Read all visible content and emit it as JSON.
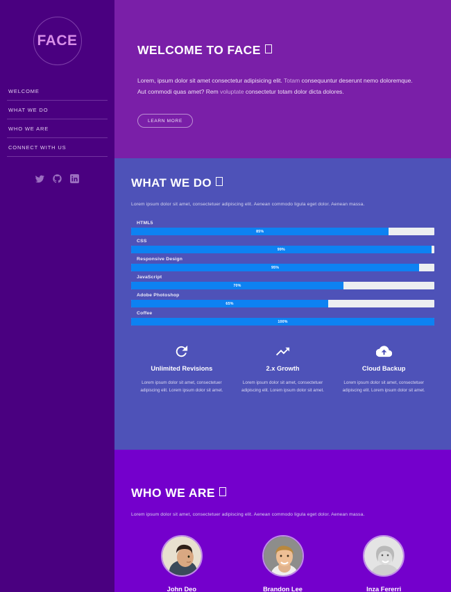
{
  "brand": {
    "logo_text": "FACE"
  },
  "sidebar": {
    "nav": [
      {
        "label": "WELCOME"
      },
      {
        "label": "WHAT WE DO"
      },
      {
        "label": "WHO WE ARE"
      },
      {
        "label": "CONNECT WITH US"
      }
    ],
    "socials": [
      {
        "name": "twitter-icon"
      },
      {
        "name": "github-icon"
      },
      {
        "name": "linkedin-icon"
      }
    ]
  },
  "welcome": {
    "title": "WELCOME TO FACE",
    "body_part1": "Lorem, ipsum dolor sit amet consectetur adipisicing elit. ",
    "body_dim1": "Totam",
    "body_part2": " consequuntur deserunt nemo doloremque. Aut commodi quas amet? Rem ",
    "body_dim2": "voluptate",
    "body_part3": " consectetur totam dolor dicta dolores.",
    "cta_label": "LEARN MORE"
  },
  "what_we_do": {
    "title": "WHAT WE DO",
    "subtitle": "Lorem ipsum dolor sit amet, consectetuer adipiscing elit. Aenean commodo ligula eget dolor. Aenean massa.",
    "features": [
      {
        "icon": "refresh-icon",
        "title": "Unlimited Revisions",
        "desc": "Lorem ipsum dolor sit amet, consectetuer adipiscing elit. Lorem ipsum dolor sit amet."
      },
      {
        "icon": "trending-up-icon",
        "title": "2.x Growth",
        "desc": "Lorem ipsum dolor sit amet, consectetuer adipiscing elit. Lorem ipsum dolor sit amet."
      },
      {
        "icon": "cloud-upload-icon",
        "title": "Cloud Backup",
        "desc": "Lorem ipsum dolor sit amet, consectetuer adipiscing elit. Lorem ipsum dolor sit amet."
      }
    ]
  },
  "who_we_are": {
    "title": "WHO WE ARE",
    "subtitle": "Lorem ipsum dolor sit amet, consectetuer adipiscing elit. Aenean commodo ligula eget dolor. Aenean massa.",
    "members": [
      {
        "name": "John Deo"
      },
      {
        "name": "Brandon Lee"
      },
      {
        "name": "Inza Fererri"
      }
    ]
  },
  "colors": {
    "sidebar_bg": "#4a0080",
    "welcome_bg": "#7a1fa8",
    "what_bg": "#4e52b8",
    "who_bg": "#7400cc",
    "bar_fill": "#0d82f2",
    "bar_track": "#eceff1",
    "logo_accent": "#d98fe8"
  },
  "chart_data": {
    "type": "bar",
    "title": "Skills",
    "orientation": "horizontal",
    "categories": [
      "HTML5",
      "CSS",
      "Responsive Design",
      "JavaScript",
      "Adobe Photoshop",
      "Coffee"
    ],
    "values": [
      85,
      99,
      95,
      70,
      65,
      100
    ],
    "labels": [
      "85%",
      "99%",
      "95%",
      "70%",
      "65%",
      "100%"
    ],
    "xlim": [
      0,
      100
    ],
    "ylabel": "",
    "xlabel": "",
    "grid": false,
    "legend": "none"
  }
}
